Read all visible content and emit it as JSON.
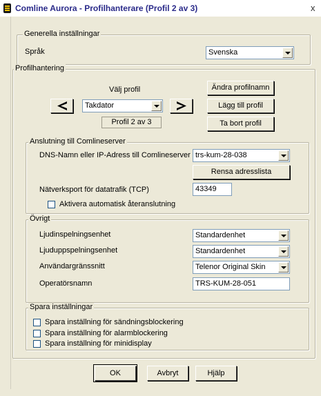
{
  "window": {
    "title": "Comline Aurora - Profilhanterare (Profil 2 av 3)",
    "close_glyph": "x"
  },
  "general": {
    "group_title": "Generella inställningar",
    "language_label": "Språk",
    "language_value": "Svenska"
  },
  "profile": {
    "group_title": "Profilhantering",
    "choose_label": "Välj profil",
    "selected_profile": "Takdator",
    "counter": "Profil 2 av 3",
    "rename_button": "Ändra profilnamn",
    "add_button": "Lägg till profil",
    "remove_button": "Ta bort profil"
  },
  "connection": {
    "group_title": "Anslutning till Comlineserver",
    "dns_label": "DNS-Namn eller IP-Adress till Comlineserver",
    "dns_value": "trs-kum-28-038",
    "clear_button": "Rensa adresslista",
    "port_label": "Nätverksport för datatrafik (TCP)",
    "port_value": "43349",
    "auto_reconnect_label": "Aktivera automatisk återanslutning",
    "auto_reconnect_checked": false
  },
  "other": {
    "group_title": "Övrigt",
    "record_label": "Ljudinspelningsenhet",
    "record_value": "Standardenhet",
    "playback_label": "Ljuduppspelningsenhet",
    "playback_value": "Standardenhet",
    "ui_label": "Användargränssnitt",
    "ui_value": "Telenor Original Skin",
    "operator_label": "Operatörsnamn",
    "operator_value": "TRS-KUM-28-051"
  },
  "save": {
    "group_title": "Spara inställningar",
    "items": [
      {
        "label": "Spara inställning för sändningsblockering",
        "checked": false
      },
      {
        "label": "Spara inställning för alarmblockering",
        "checked": false
      },
      {
        "label": "Spara inställning för minidisplay",
        "checked": false
      }
    ]
  },
  "buttons": {
    "ok": "OK",
    "cancel": "Avbryt",
    "help": "Hjälp"
  }
}
